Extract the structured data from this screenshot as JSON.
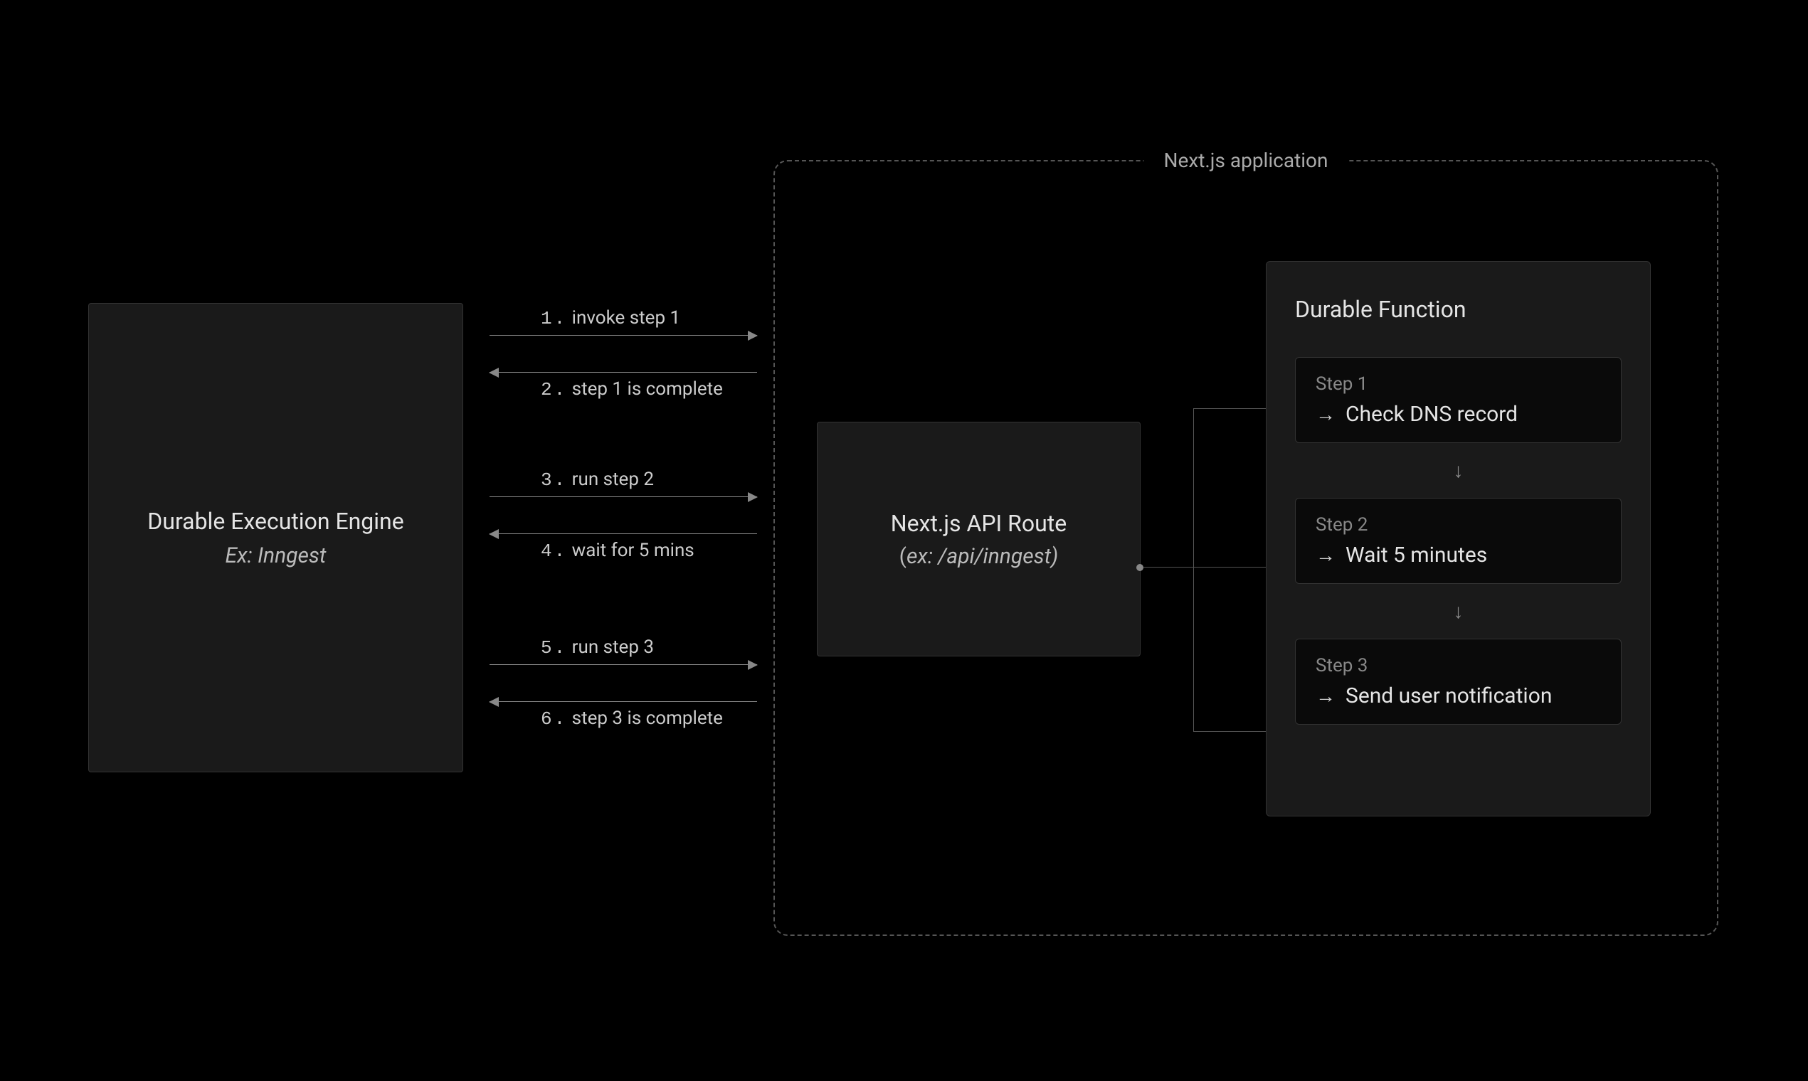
{
  "engine": {
    "title": "Durable Execution Engine",
    "subtitle": "Ex: Inngest"
  },
  "arrows": [
    {
      "num": "1.",
      "text": "invoke step 1"
    },
    {
      "num": "2.",
      "text": "step 1 is complete"
    },
    {
      "num": "3.",
      "text": "run step 2"
    },
    {
      "num": "4.",
      "text": "wait for 5 mins"
    },
    {
      "num": "5.",
      "text": "run step 3"
    },
    {
      "num": "6.",
      "text": "step 3 is complete"
    }
  ],
  "app": {
    "label": "Next.js application",
    "api": {
      "title": "Next.js API Route",
      "subtitle_prefix": "(",
      "subtitle_italic": "ex: /api/inngest)",
      "subtitle_suffix": ""
    },
    "func": {
      "title": "Durable Function",
      "steps": [
        {
          "label": "Step 1",
          "action": "Check DNS record"
        },
        {
          "label": "Step 2",
          "action": "Wait 5 minutes"
        },
        {
          "label": "Step 3",
          "action": "Send user notification"
        }
      ]
    }
  }
}
